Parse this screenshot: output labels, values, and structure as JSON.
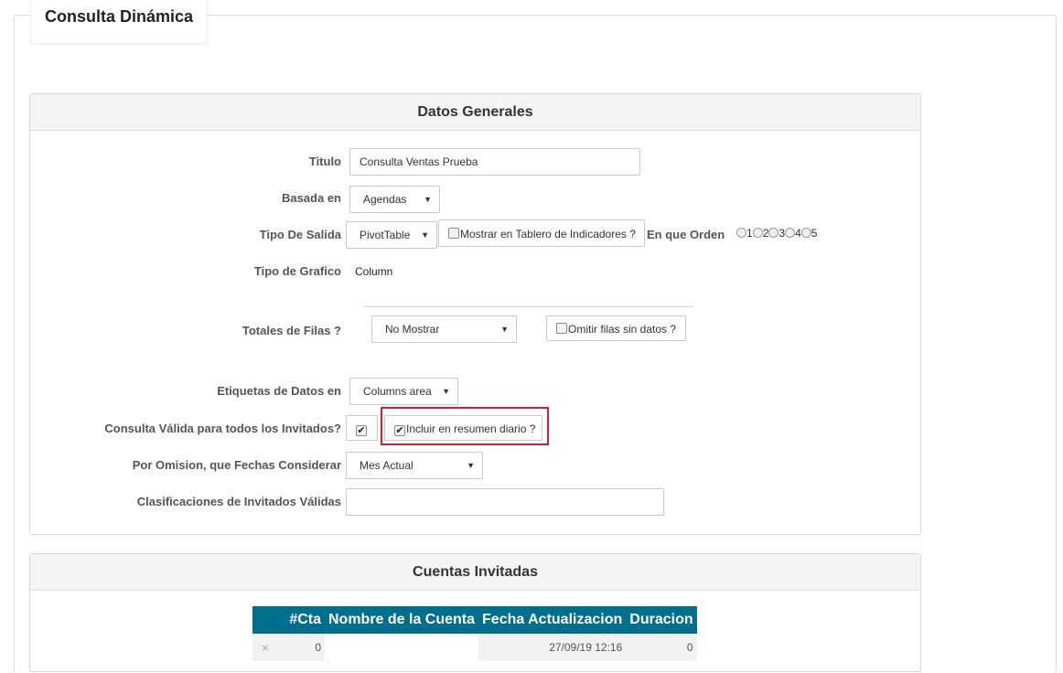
{
  "page": {
    "title": "Consulta Dinámica"
  },
  "general": {
    "header": "Datos Generales",
    "titulo": {
      "label": "Titulo",
      "value": "Consulta Ventas Prueba"
    },
    "basada_en": {
      "label": "Basada en",
      "value": "Agendas"
    },
    "tipo_salida": {
      "label": "Tipo De Salida",
      "value": "PivotTable"
    },
    "mostrar_tablero": {
      "label": "Mostrar en Tablero de Indicadores ?",
      "checked": false
    },
    "orden": {
      "label": "En que Orden",
      "options": [
        "1",
        "2",
        "3",
        "4",
        "5"
      ]
    },
    "tipo_grafico": {
      "label": "Tipo de Grafico",
      "value": "Column"
    },
    "totales_filas": {
      "label": "Totales de Filas ?",
      "value": "No Mostrar"
    },
    "omitir_filas": {
      "label": "Omitir filas sin datos ?",
      "checked": false
    },
    "etiquetas": {
      "label": "Etiquetas de Datos en",
      "value": "Columns area"
    },
    "valida_invitados": {
      "label": "Consulta Válida para todos los Invitados?",
      "checked": true
    },
    "resumen_diario": {
      "label": "Incluir en resumen diario ?",
      "checked": true
    },
    "fechas": {
      "label": "Por Omision, que Fechas Considerar",
      "value": "Mes Actual"
    },
    "clasificaciones": {
      "label": "Clasificaciones de Invitados Válidas",
      "value": ""
    }
  },
  "accounts": {
    "header": "Cuentas Invitadas",
    "columns": [
      "#Cta",
      "Nombre de la Cuenta",
      "Fecha Actualizacion",
      "Duracion"
    ],
    "rows": [
      {
        "remove": "×",
        "cta": "0",
        "nombre": "",
        "fecha": "27/09/19 12:16",
        "duracion": "0"
      }
    ]
  }
}
